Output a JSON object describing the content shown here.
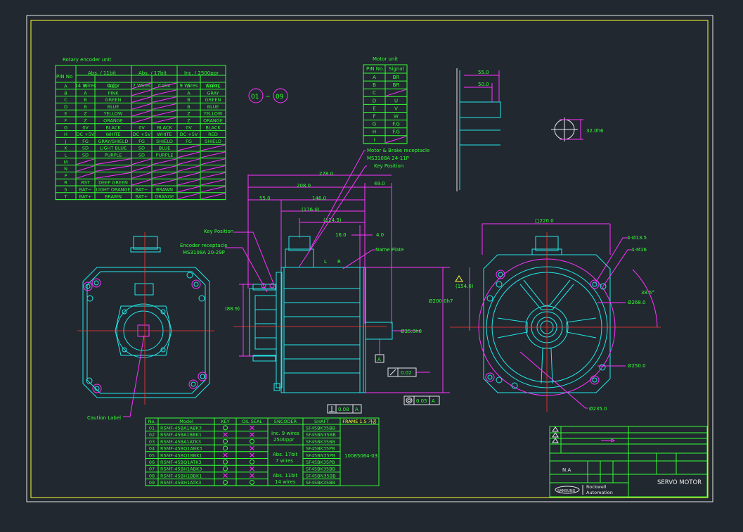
{
  "encoder_table": {
    "caption": "Rotary encoder unit",
    "header_pin": "PIN No",
    "groups": [
      "Abs. / 11bit",
      "Abs. / 17bit",
      "Inc. / 2500ppr"
    ],
    "sub_headers": [
      "14 Wires",
      "Color",
      "7 Wires",
      "Color",
      "9 Wires",
      "Color"
    ],
    "rows": [
      [
        "A",
        "A",
        "RED",
        "",
        "",
        "A",
        "WHITE"
      ],
      [
        "B",
        "A",
        "PINK",
        "",
        "",
        "A",
        "GRAY"
      ],
      [
        "C",
        "B",
        "GREEN",
        "",
        "",
        "B",
        "GREEN"
      ],
      [
        "D",
        "B",
        "BLUE",
        "",
        "",
        "B",
        "BLUE"
      ],
      [
        "E",
        "Z",
        "YELLOW",
        "",
        "",
        "Z",
        "YELLOW"
      ],
      [
        "F",
        "Z",
        "ORANGE",
        "",
        "",
        "Z",
        "ORANGE"
      ],
      [
        "G",
        "0V",
        "BLACK",
        "0V",
        "BLACK",
        "0V",
        "BLACK"
      ],
      [
        "H",
        "DC +5V",
        "WHITE",
        "DC +5V",
        "WHITE",
        "DC +5V",
        "RED"
      ],
      [
        "J",
        "FG",
        "GRAY/SHIELD",
        "FG",
        "SHIELD",
        "FG",
        "SHIELD"
      ],
      [
        "K",
        "SD",
        "LIGHT BLUE",
        "SD",
        "BLUE",
        "",
        ""
      ],
      [
        "L",
        "SD",
        "PURPLE",
        "SD",
        "PURPLE",
        "",
        ""
      ],
      [
        "M",
        "",
        "",
        "",
        "",
        "",
        ""
      ],
      [
        "N",
        "",
        "",
        "",
        "",
        "",
        ""
      ],
      [
        "P",
        "",
        "",
        "",
        "",
        "",
        ""
      ],
      [
        "R",
        "RST",
        "DEEP GREEN",
        "",
        "",
        "",
        ""
      ],
      [
        "S",
        "BAT−",
        "LIGHT ORANGE",
        "BAT−",
        "BRAWN",
        "",
        ""
      ],
      [
        "T",
        "BAT+",
        "BRAWN",
        "BAT+",
        "ORANGE",
        "",
        ""
      ]
    ]
  },
  "motor_table": {
    "caption": "Motor unit",
    "headers": [
      "PIN No.",
      "Signal"
    ],
    "rows": [
      [
        "A",
        "BR"
      ],
      [
        "B",
        "BR"
      ],
      [
        "C",
        ""
      ],
      [
        "D",
        "U"
      ],
      [
        "E",
        "V"
      ],
      [
        "F",
        "W"
      ],
      [
        "G",
        "F.G"
      ],
      [
        "H",
        "F.G"
      ],
      [
        "I",
        ""
      ]
    ]
  },
  "range_badge": {
    "from": "01",
    "sep": "~",
    "to": "09"
  },
  "side_view": {
    "dims": [
      "278.0",
      "208.0",
      "49.0",
      "55.0",
      "146.0",
      "(176.0)",
      "(114.5)",
      "16.0",
      "4.0",
      "(88.9)",
      "Ø200.0h7",
      "Ø35.0h6",
      "(154.0)"
    ],
    "labels": {
      "motor_receptacle": "Motor & Brake receptacle",
      "motor_receptacle_part": "MS3108A 24-11P",
      "key_position_top": "Key Position",
      "key_position": "Key Position",
      "encoder_receptacle": "Encoder receptacle",
      "encoder_receptacle_part": "MS3108A 20-29P",
      "name_plate": "Name Plate",
      "l_mark": "L",
      "r_mark": "R",
      "datum_a": "A",
      "runout": "0.02",
      "perp_val": "0.08",
      "perp_ref": "A",
      "conc_val": "0.05",
      "conc_ref": "A"
    }
  },
  "shaft_detail": {
    "dims": [
      "55.0",
      "50.0",
      "32.0h6"
    ]
  },
  "front_view": {
    "dims": [
      "□220.0",
      "4-Ø13.5",
      "4-M16",
      "Ø268.0",
      "Ø250.0",
      "Ø235.0",
      "38.5°"
    ]
  },
  "rear_view": {
    "caption": "Caution Label"
  },
  "model_table": {
    "headers": [
      "No.",
      "Model",
      "KEY",
      "OIL SEAL",
      "ENCODER",
      "SHAFT",
      "FRAME 1.5 가공"
    ],
    "rows": [
      [
        "01",
        "RSMF-45BA1ABK3",
        "O",
        "X",
        "SF45BK35BB"
      ],
      [
        "02",
        "RSMF-45BA1BBK1",
        "X",
        "X",
        "SF45BN35BB"
      ],
      [
        "03",
        "RSMF-45BA1ATK3",
        "O",
        "O",
        "SF45BK35BB"
      ],
      [
        "04",
        "RSMF-45BQ1ABK3",
        "O",
        "X",
        "SF45BK35PB"
      ],
      [
        "05",
        "RSMF-45BQ1BBK1",
        "X",
        "X",
        "SF45BN35PB"
      ],
      [
        "06",
        "RSMF-45BQ1ATK3",
        "O",
        "O",
        "SF45BK35PB"
      ],
      [
        "07",
        "RSMF-45BH1ABK3",
        "O",
        "X",
        "SF45BK35BB"
      ],
      [
        "08",
        "RSMF-45BH1BBK1",
        "X",
        "X",
        "SF45BN35BB"
      ],
      [
        "09",
        "RSMF-45BH1ATK3",
        "O",
        "O",
        "SF45BK35BB"
      ]
    ],
    "encoder_groups": [
      {
        "line1": "Inc. 9 wires",
        "line2": "2500ppr"
      },
      {
        "line1": "Abs. 17bit",
        "line2": "7 wires"
      },
      {
        "line1": "Abs. 11bit",
        "line2": "14 wires"
      }
    ],
    "frame_code": "10085064-03"
  },
  "title_block": {
    "title": "SERVO MOTOR",
    "scale": "N.A",
    "company_line1": "Rockwell",
    "company_line2": "Automation",
    "logo_text": "SAMSUNG"
  },
  "colors": {
    "background": "#212830",
    "green": "#33ff33",
    "cyan": "#22e8e8",
    "magenta": "#ff33ff",
    "white": "#e8e8e8"
  }
}
